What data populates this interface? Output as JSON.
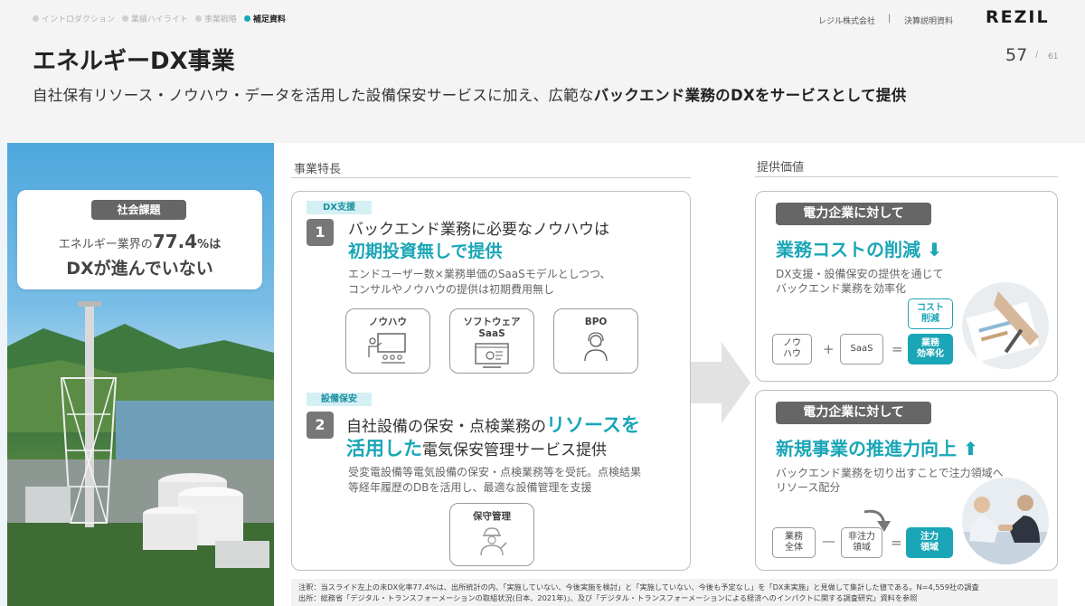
{
  "breadcrumb": [
    "イントロダクション",
    "業績ハイライト",
    "事業戦略",
    "補足資料"
  ],
  "company": "レジル株式会社",
  "doc_type": "決算説明資料",
  "logo": "REZIL",
  "title": "エネルギーDX事業",
  "page": {
    "current": "57",
    "slash": "/",
    "total": "61"
  },
  "subtitle": {
    "prefix": "自社保有リソース・ノウハウ・データを活用した設備保安サービスに加え、広範な",
    "bold": "バックエンド業務のDXをサービスとして提供"
  },
  "issue": {
    "tag": "社会課題",
    "line1_prefix": "エネルギー業界の",
    "line1_value": "77.4",
    "line1_unit": "%は",
    "line2": "DXが進んでいない"
  },
  "features": {
    "heading": "事業特長",
    "item1": {
      "tag": "DX支援",
      "num": "1",
      "title": "バックエンド業務に必要なノウハウは",
      "highlight": "初期投資無しで提供",
      "desc1": "エンドユーザー数×業務単価のSaaSモデルとしつつ、",
      "desc2": "コンサルやノウハウの提供は初期費用無し",
      "icons": [
        {
          "label": "ノウハウ",
          "icon": "presentation-icon"
        },
        {
          "label": "ソフトウェア",
          "label2": "SaaS",
          "icon": "software-icon"
        },
        {
          "label": "BPO",
          "icon": "operator-icon"
        }
      ]
    },
    "item2": {
      "tag": "設備保安",
      "num": "2",
      "title_prefix": "自社設備の保安・点検業務の",
      "highlight1": "リソースを",
      "highlight2": "活用した",
      "title_suffix": "電気保安管理サービス提供",
      "desc1": "受変電設備等電気設備の保安・点検業務等を受託。点検結果",
      "desc2": "等経年履歴のDBを活用し、最適な設備管理を支援",
      "icon": {
        "label": "保守管理",
        "icon": "maintenance-worker-icon"
      }
    }
  },
  "value": {
    "heading": "提供価値",
    "box1": {
      "tag": "電力企業に対して",
      "headline": "業務コストの削減",
      "desc1": "DX支援・設備保安の提供を通じて",
      "desc2": "バックエンド業務を効率化",
      "chip_a1": "ノウ",
      "chip_a2": "ハウ",
      "plus": "+",
      "chip_b": "SaaS",
      "eq": "=",
      "result1": "業務",
      "result2": "効率化",
      "callout1": "コスト",
      "callout2": "削減"
    },
    "box2": {
      "tag": "電力企業に対して",
      "headline": "新規事業の推進力向上",
      "desc1": "バックエンド業務を切り出すことで注力領域へ",
      "desc2": "リソース配分",
      "chip_a1": "業務",
      "chip_a2": "全体",
      "minus": "—",
      "chip_b1": "非注力",
      "chip_b2": "領域",
      "eq": "=",
      "result1": "注力",
      "result2": "領域"
    }
  },
  "footnote": {
    "line1": "注釈：当スライド左上の未DX化率77.4%は、出所統計の内、「実施していない、今後実施を検討」と「実施していない、今後も予定なし」を「DX未実施」と見做して集計した値である。N=4,559社の調査",
    "line2": "出所：総務省「デジタル・トランスフォーメーションの取組状況(日本、2021年)」、及び「デジタル・トランスフォーメーションによる経済へのインパクトに関する調査研究」資料を参照"
  },
  "colors": {
    "accent": "#1aa6b7",
    "tag_bg": "#666666",
    "header_bg": "#f4f4f4"
  }
}
